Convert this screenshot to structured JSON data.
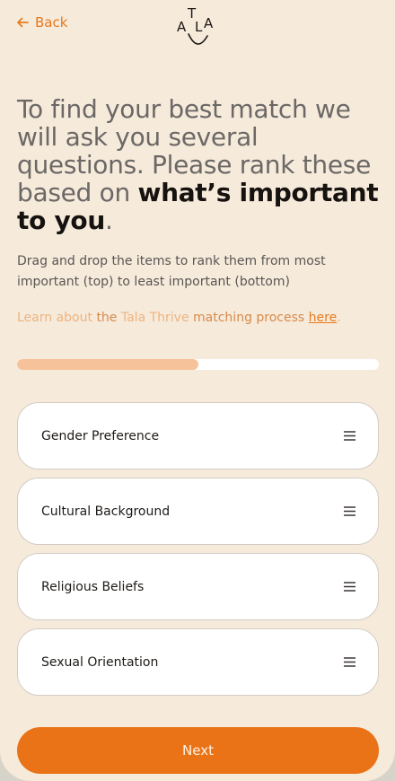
{
  "nav": {
    "back_label": "Back",
    "logo_letters": [
      "A",
      "T",
      "L",
      "A"
    ]
  },
  "headline": {
    "muted": "To find your best match we will ask you several questions. Please rank these based on ",
    "emphasis": "what’s important to you",
    "end": "."
  },
  "instructions": "Drag and drop the items to rank them from most important (top) to least important (bottom)",
  "learn_more": {
    "before": "Learn about ",
    "the_word": "the",
    "brand": " Tala Thrive",
    "middle": " matching process ",
    "link_label": "here",
    "end": "."
  },
  "progress": {
    "fraction": 0.5
  },
  "rank_items": [
    {
      "label": "Gender Preference",
      "icon": "drag-handle-icon"
    },
    {
      "label": "Cultural Background",
      "icon": "drag-handle-icon"
    },
    {
      "label": "Religious Beliefs",
      "icon": "drag-handle-icon"
    },
    {
      "label": "Sexual Orientation",
      "icon": "drag-handle-icon"
    }
  ],
  "next_label": "Next",
  "colors": {
    "accent": "#ea7317",
    "background": "#f6eadb",
    "progress_fill": "#f6c299"
  }
}
